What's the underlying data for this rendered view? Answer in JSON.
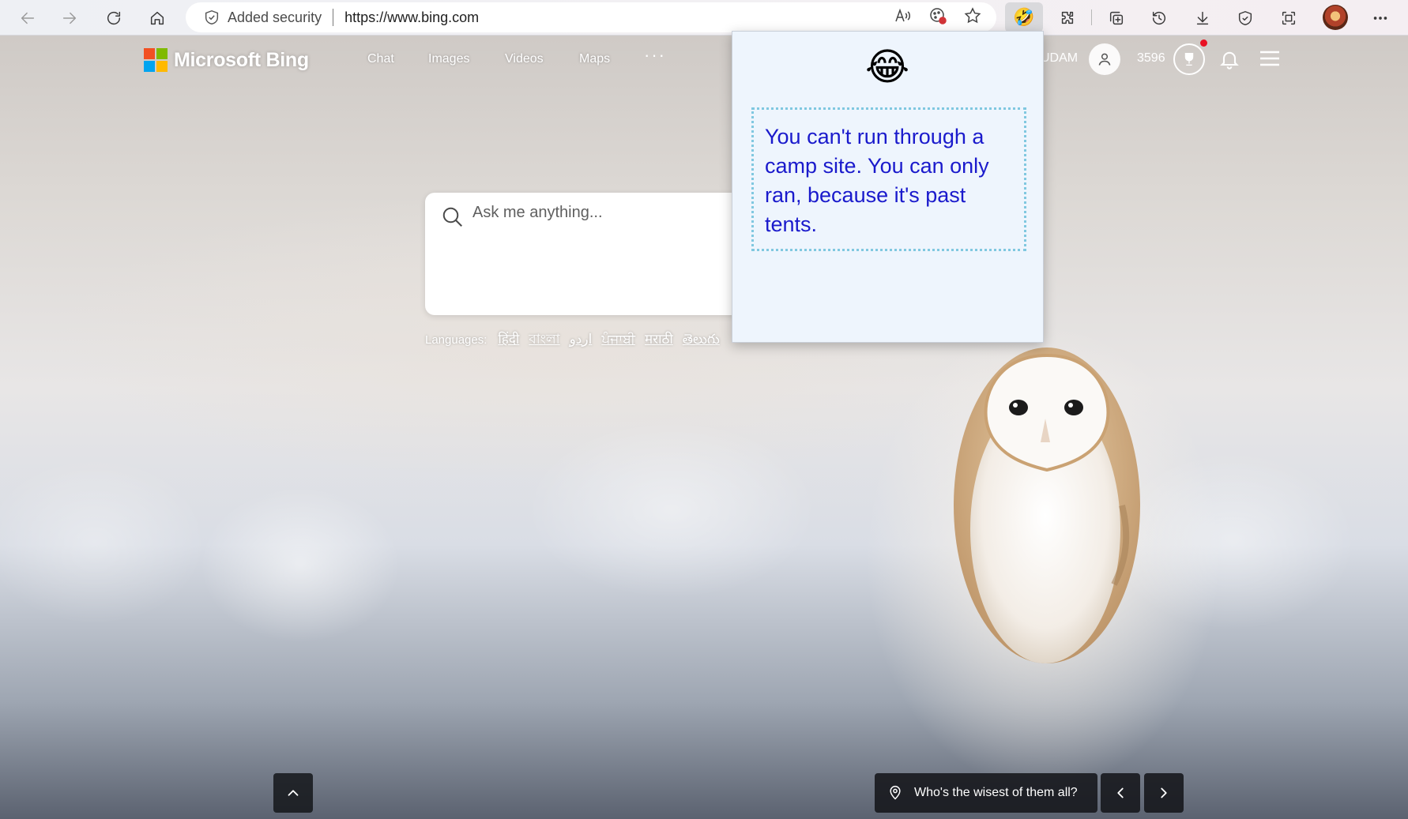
{
  "browser": {
    "security_label": "Added security",
    "url": "https://www.bing.com"
  },
  "bing": {
    "brand": "Microsoft Bing",
    "nav": [
      "Chat",
      "Images",
      "Videos",
      "Maps"
    ],
    "more": "···",
    "user_name": "UDAM",
    "points": "3596",
    "search_placeholder": "Ask me anything...",
    "languages_label": "Languages:",
    "languages": [
      "हिंदी",
      "বাংলা",
      "اردو",
      "ਪੰਜਾਬੀ",
      "मराठी",
      "తెలుగు"
    ]
  },
  "popup": {
    "emoji": "😂",
    "joke": "You can't run through a camp site. You can only ran, because it's past tents."
  },
  "footer": {
    "caption": "Who's the wisest of them all?"
  },
  "colors": {
    "popup_bg": "#eef5fd",
    "joke_text": "#1a1acc",
    "joke_border": "#80c8e0"
  }
}
